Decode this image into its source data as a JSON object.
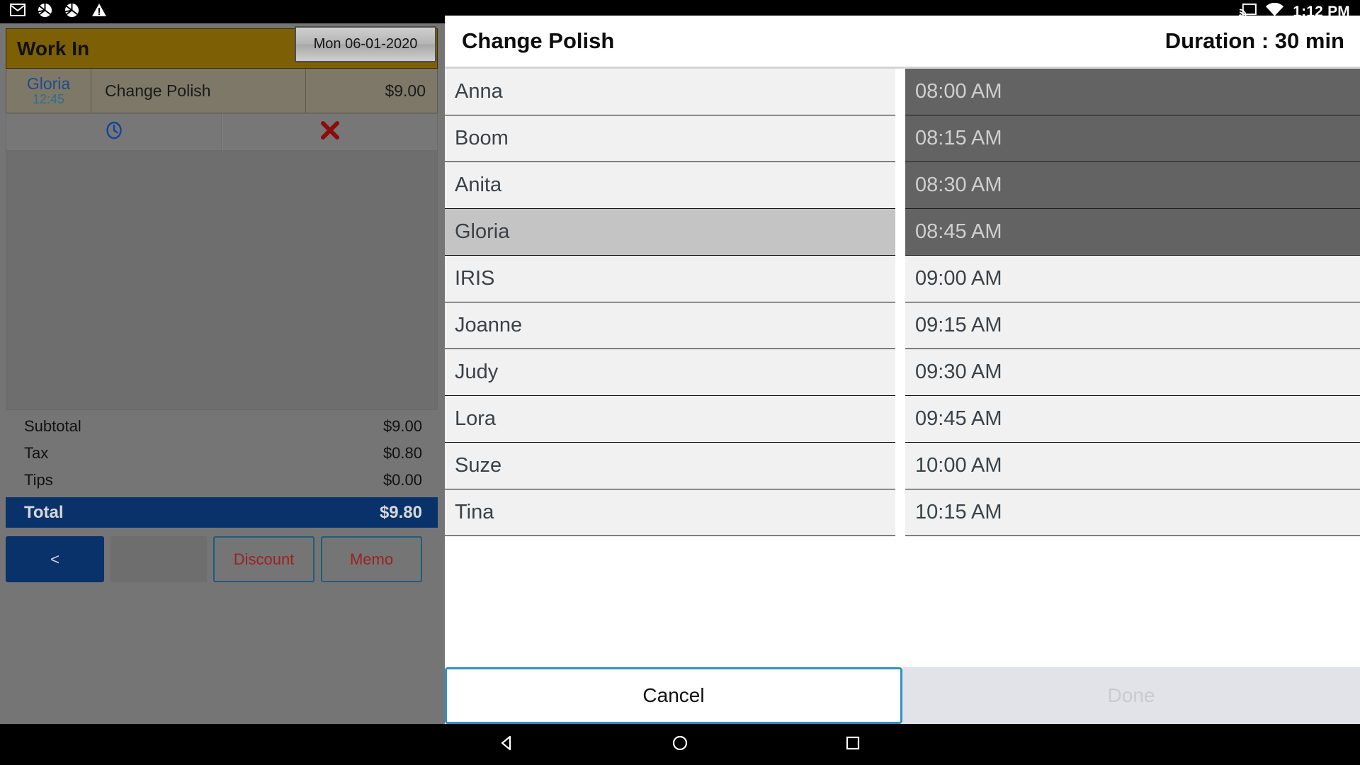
{
  "statusbar": {
    "time": "1:12 PM",
    "icons": [
      "gmail-icon",
      "aperture-icon",
      "aperture-icon",
      "warning-icon"
    ],
    "right_icons": [
      "cast-icon",
      "wifi-icon"
    ]
  },
  "pos": {
    "ticket_title": "Work In",
    "date_button": "Mon 06-01-2020",
    "ticket_rows": [
      {
        "tech": "Gloria",
        "time": "12:45",
        "service": "Change Polish",
        "price": "$9.00"
      }
    ],
    "action_buttons": [
      {
        "name": "clock-button",
        "icon": "clock-icon"
      },
      {
        "name": "remove-button",
        "icon": "close-x-icon"
      }
    ],
    "totals": [
      {
        "label": "Subtotal",
        "value": "$9.00"
      },
      {
        "label": "Tax",
        "value": "$0.80"
      },
      {
        "label": "Tips",
        "value": "$0.00"
      }
    ],
    "grand_total": {
      "label": "Total",
      "value": "$9.80"
    },
    "buttons": {
      "back": "<",
      "blank": "",
      "discount": "Discount",
      "memo": "Memo"
    }
  },
  "dialog": {
    "title": "Change Polish",
    "duration": "Duration : 30 min",
    "technicians": [
      {
        "name": "Anna",
        "selected": false
      },
      {
        "name": "Boom",
        "selected": false
      },
      {
        "name": "Anita",
        "selected": false
      },
      {
        "name": "Gloria",
        "selected": true
      },
      {
        "name": "IRIS",
        "selected": false
      },
      {
        "name": "Joanne",
        "selected": false
      },
      {
        "name": "Judy",
        "selected": false
      },
      {
        "name": "Lora",
        "selected": false
      },
      {
        "name": "Suze",
        "selected": false
      },
      {
        "name": "Tina",
        "selected": false
      }
    ],
    "times": [
      {
        "label": "08:00 AM",
        "disabled": true
      },
      {
        "label": "08:15 AM",
        "disabled": true
      },
      {
        "label": "08:30 AM",
        "disabled": true
      },
      {
        "label": "08:45 AM",
        "disabled": true
      },
      {
        "label": "09:00 AM",
        "disabled": false
      },
      {
        "label": "09:15 AM",
        "disabled": false
      },
      {
        "label": "09:30 AM",
        "disabled": false
      },
      {
        "label": "09:45 AM",
        "disabled": false
      },
      {
        "label": "10:00 AM",
        "disabled": false
      },
      {
        "label": "10:15 AM",
        "disabled": false
      }
    ],
    "cancel_label": "Cancel",
    "done_label": "Done"
  },
  "navbar": {
    "buttons": [
      "back-nav-button",
      "home-nav-button",
      "recents-nav-button"
    ]
  },
  "colors": {
    "header_gold": "#7d5f05",
    "total_navy": "#09326b",
    "accent_blue": "#3290c4",
    "discount_red": "#9b2222",
    "panel_gray": "#757575"
  }
}
